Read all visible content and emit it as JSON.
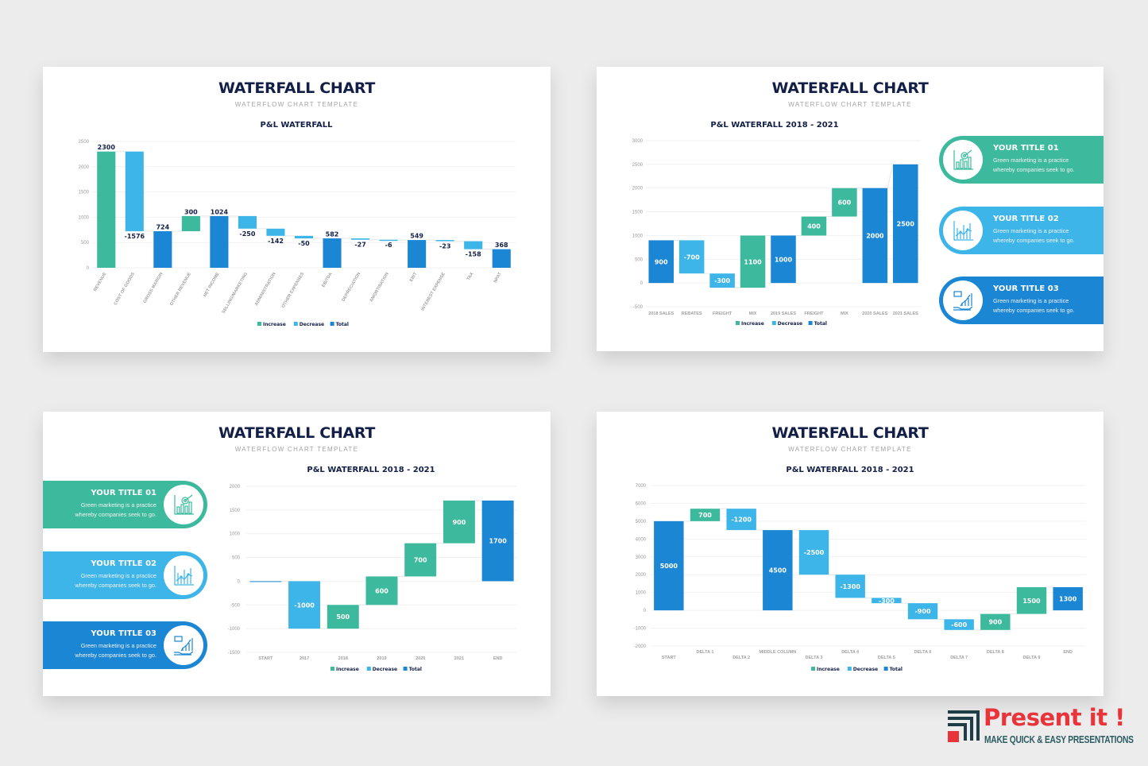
{
  "colors": {
    "increase": "#3dba9d",
    "decrease": "#3db5e8",
    "total": "#1a86d4",
    "title": "#141f47",
    "card1": "#3dba9d",
    "card2": "#3db5e8",
    "card3": "#1a86d4"
  },
  "slides": [
    {
      "title": "WATERFALL CHART",
      "subtitle": "WATERFLOW CHART TEMPLATE"
    },
    {
      "title": "WATERFALL CHART",
      "subtitle": "WATERFLOW CHART TEMPLATE"
    },
    {
      "title": "WATERFALL CHART",
      "subtitle": "WATERFLOW CHART TEMPLATE"
    },
    {
      "title": "WATERFALL CHART",
      "subtitle": "WATERFLOW CHART TEMPLATE"
    }
  ],
  "legend": {
    "increase": "Increase",
    "decrease": "Decrease",
    "total": "Total"
  },
  "cards": [
    {
      "title": "YOUR TITLE 01",
      "desc_line1": "Green marketing is a practice",
      "desc_line2": "whereby companies seek to go.",
      "icon": "target-chart-icon"
    },
    {
      "title": "YOUR TITLE 02",
      "desc_line1": "Green marketing is a practice",
      "desc_line2": "whereby companies seek to go.",
      "icon": "line-bar-chart-icon"
    },
    {
      "title": "YOUR TITLE 03",
      "desc_line1": "Green marketing is a practice",
      "desc_line2": "whereby companies seek to go.",
      "icon": "hand-growth-chart-icon"
    }
  ],
  "brand": {
    "name": "Present it !",
    "tagline": "MAKE QUICK & EASY PRESENTATIONS"
  },
  "chart_data": [
    {
      "type": "waterfall",
      "title": "P&L WATERFALL",
      "ylim": [
        0,
        2500
      ],
      "yticks": [
        0,
        500,
        1000,
        1500,
        2000,
        2500
      ],
      "grid": true,
      "legend": "bottom",
      "label_position": "outside",
      "categories": [
        "REVENUE",
        "COST OF GOODS",
        "GROSS MARGIN",
        "OTHER REVENUE",
        "NET INCOME",
        "SELLING/MARKETING",
        "ADMINISTRATION",
        "OTHER EXPENSES",
        "EBITDA",
        "DEPRECIATION",
        "AMORTISATION",
        "EBIT",
        "INTEREST EXPENSE",
        "TAX",
        "NPAT"
      ],
      "values": [
        2300,
        -1576,
        724,
        300,
        1024,
        -250,
        -142,
        -50,
        582,
        -27,
        -6,
        549,
        -23,
        -158,
        368
      ],
      "kinds": [
        "increase",
        "decrease",
        "total",
        "increase",
        "total",
        "decrease",
        "decrease",
        "decrease",
        "total",
        "decrease",
        "decrease",
        "total",
        "decrease",
        "decrease",
        "total"
      ],
      "labels": [
        "2300",
        "-1576",
        "724",
        "300",
        "1024",
        "-250",
        "-142",
        "-50",
        "582",
        "-27",
        "-6",
        "549",
        "-23",
        "-158",
        "368"
      ]
    },
    {
      "type": "waterfall",
      "title": "P&L WATERFALL 2018 - 2021",
      "ylim": [
        -500,
        3000
      ],
      "yticks": [
        -500,
        0,
        500,
        1000,
        1500,
        2000,
        2500,
        3000
      ],
      "grid": true,
      "legend": "bottom",
      "label_position": "inside",
      "categories": [
        "2018 SALES",
        "REBATES",
        "FREIGHT",
        "MIX",
        "2019 SALES",
        "FREIGHT",
        "MIX",
        "2020 SALES",
        "2021 SALES"
      ],
      "values": [
        900,
        -700,
        -300,
        1100,
        1000,
        400,
        600,
        2000,
        2500
      ],
      "kinds": [
        "total",
        "decrease",
        "decrease",
        "increase",
        "total",
        "increase",
        "increase",
        "total",
        "total"
      ],
      "labels": [
        "900",
        "-700",
        "-300",
        "1100",
        "1000",
        "400",
        "600",
        "2000",
        "2500"
      ]
    },
    {
      "type": "waterfall",
      "title": "P&L WATERFALL 2018 - 2021",
      "ylim": [
        -1500,
        2000
      ],
      "yticks": [
        -1500,
        -1000,
        -500,
        0,
        500,
        1000,
        1500,
        2000
      ],
      "grid": true,
      "legend": "bottom",
      "label_position": "inside",
      "categories": [
        "START",
        "2017",
        "2018",
        "2019",
        "2020",
        "2021",
        "END"
      ],
      "values": [
        0,
        -1000,
        500,
        600,
        700,
        900,
        1700
      ],
      "kinds": [
        "total",
        "decrease",
        "increase",
        "increase",
        "increase",
        "increase",
        "total"
      ],
      "labels": [
        "",
        "-1000",
        "500",
        "600",
        "700",
        "900",
        "1700"
      ]
    },
    {
      "type": "waterfall",
      "title": "P&L WATERFALL 2018 - 2021",
      "ylim": [
        -2000,
        7000
      ],
      "yticks": [
        -2000,
        -1000,
        0,
        1000,
        2000,
        3000,
        4000,
        5000,
        6000,
        7000
      ],
      "grid": true,
      "legend": "bottom",
      "label_position": "inside",
      "categories": [
        "START",
        "DELTA 1",
        "DELTA 2",
        "MIDDLE COLUMN",
        "DELTA 3",
        "DELTA 4",
        "DELTA 5",
        "DELTA 6",
        "DELTA 7",
        "DELTA 8",
        "DELTA 9",
        "END"
      ],
      "values": [
        5000,
        700,
        -1200,
        4500,
        -2500,
        -1300,
        -300,
        -900,
        -600,
        900,
        1500,
        1300
      ],
      "kinds": [
        "total",
        "increase",
        "decrease",
        "total",
        "decrease",
        "decrease",
        "decrease",
        "decrease",
        "decrease",
        "increase",
        "increase",
        "total"
      ],
      "labels": [
        "5000",
        "700",
        "-1200",
        "4500",
        "-2500",
        "-1300",
        "-300",
        "-900",
        "-600",
        "900",
        "1500",
        "1300"
      ]
    }
  ]
}
